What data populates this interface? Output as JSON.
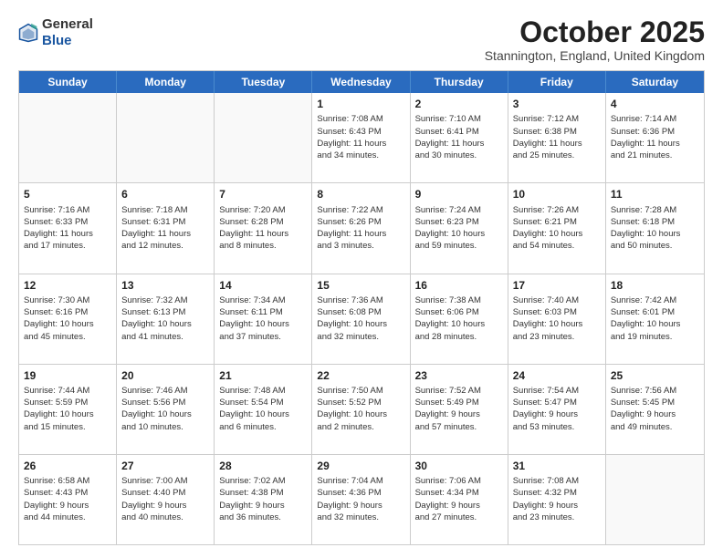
{
  "header": {
    "logo_line1": "General",
    "logo_line2": "Blue",
    "month": "October 2025",
    "location": "Stannington, England, United Kingdom"
  },
  "days_of_week": [
    "Sunday",
    "Monday",
    "Tuesday",
    "Wednesday",
    "Thursday",
    "Friday",
    "Saturday"
  ],
  "weeks": [
    [
      {
        "day": "",
        "info": ""
      },
      {
        "day": "",
        "info": ""
      },
      {
        "day": "",
        "info": ""
      },
      {
        "day": "1",
        "info": "Sunrise: 7:08 AM\nSunset: 6:43 PM\nDaylight: 11 hours\nand 34 minutes."
      },
      {
        "day": "2",
        "info": "Sunrise: 7:10 AM\nSunset: 6:41 PM\nDaylight: 11 hours\nand 30 minutes."
      },
      {
        "day": "3",
        "info": "Sunrise: 7:12 AM\nSunset: 6:38 PM\nDaylight: 11 hours\nand 25 minutes."
      },
      {
        "day": "4",
        "info": "Sunrise: 7:14 AM\nSunset: 6:36 PM\nDaylight: 11 hours\nand 21 minutes."
      }
    ],
    [
      {
        "day": "5",
        "info": "Sunrise: 7:16 AM\nSunset: 6:33 PM\nDaylight: 11 hours\nand 17 minutes."
      },
      {
        "day": "6",
        "info": "Sunrise: 7:18 AM\nSunset: 6:31 PM\nDaylight: 11 hours\nand 12 minutes."
      },
      {
        "day": "7",
        "info": "Sunrise: 7:20 AM\nSunset: 6:28 PM\nDaylight: 11 hours\nand 8 minutes."
      },
      {
        "day": "8",
        "info": "Sunrise: 7:22 AM\nSunset: 6:26 PM\nDaylight: 11 hours\nand 3 minutes."
      },
      {
        "day": "9",
        "info": "Sunrise: 7:24 AM\nSunset: 6:23 PM\nDaylight: 10 hours\nand 59 minutes."
      },
      {
        "day": "10",
        "info": "Sunrise: 7:26 AM\nSunset: 6:21 PM\nDaylight: 10 hours\nand 54 minutes."
      },
      {
        "day": "11",
        "info": "Sunrise: 7:28 AM\nSunset: 6:18 PM\nDaylight: 10 hours\nand 50 minutes."
      }
    ],
    [
      {
        "day": "12",
        "info": "Sunrise: 7:30 AM\nSunset: 6:16 PM\nDaylight: 10 hours\nand 45 minutes."
      },
      {
        "day": "13",
        "info": "Sunrise: 7:32 AM\nSunset: 6:13 PM\nDaylight: 10 hours\nand 41 minutes."
      },
      {
        "day": "14",
        "info": "Sunrise: 7:34 AM\nSunset: 6:11 PM\nDaylight: 10 hours\nand 37 minutes."
      },
      {
        "day": "15",
        "info": "Sunrise: 7:36 AM\nSunset: 6:08 PM\nDaylight: 10 hours\nand 32 minutes."
      },
      {
        "day": "16",
        "info": "Sunrise: 7:38 AM\nSunset: 6:06 PM\nDaylight: 10 hours\nand 28 minutes."
      },
      {
        "day": "17",
        "info": "Sunrise: 7:40 AM\nSunset: 6:03 PM\nDaylight: 10 hours\nand 23 minutes."
      },
      {
        "day": "18",
        "info": "Sunrise: 7:42 AM\nSunset: 6:01 PM\nDaylight: 10 hours\nand 19 minutes."
      }
    ],
    [
      {
        "day": "19",
        "info": "Sunrise: 7:44 AM\nSunset: 5:59 PM\nDaylight: 10 hours\nand 15 minutes."
      },
      {
        "day": "20",
        "info": "Sunrise: 7:46 AM\nSunset: 5:56 PM\nDaylight: 10 hours\nand 10 minutes."
      },
      {
        "day": "21",
        "info": "Sunrise: 7:48 AM\nSunset: 5:54 PM\nDaylight: 10 hours\nand 6 minutes."
      },
      {
        "day": "22",
        "info": "Sunrise: 7:50 AM\nSunset: 5:52 PM\nDaylight: 10 hours\nand 2 minutes."
      },
      {
        "day": "23",
        "info": "Sunrise: 7:52 AM\nSunset: 5:49 PM\nDaylight: 9 hours\nand 57 minutes."
      },
      {
        "day": "24",
        "info": "Sunrise: 7:54 AM\nSunset: 5:47 PM\nDaylight: 9 hours\nand 53 minutes."
      },
      {
        "day": "25",
        "info": "Sunrise: 7:56 AM\nSunset: 5:45 PM\nDaylight: 9 hours\nand 49 minutes."
      }
    ],
    [
      {
        "day": "26",
        "info": "Sunrise: 6:58 AM\nSunset: 4:43 PM\nDaylight: 9 hours\nand 44 minutes."
      },
      {
        "day": "27",
        "info": "Sunrise: 7:00 AM\nSunset: 4:40 PM\nDaylight: 9 hours\nand 40 minutes."
      },
      {
        "day": "28",
        "info": "Sunrise: 7:02 AM\nSunset: 4:38 PM\nDaylight: 9 hours\nand 36 minutes."
      },
      {
        "day": "29",
        "info": "Sunrise: 7:04 AM\nSunset: 4:36 PM\nDaylight: 9 hours\nand 32 minutes."
      },
      {
        "day": "30",
        "info": "Sunrise: 7:06 AM\nSunset: 4:34 PM\nDaylight: 9 hours\nand 27 minutes."
      },
      {
        "day": "31",
        "info": "Sunrise: 7:08 AM\nSunset: 4:32 PM\nDaylight: 9 hours\nand 23 minutes."
      },
      {
        "day": "",
        "info": ""
      }
    ]
  ]
}
